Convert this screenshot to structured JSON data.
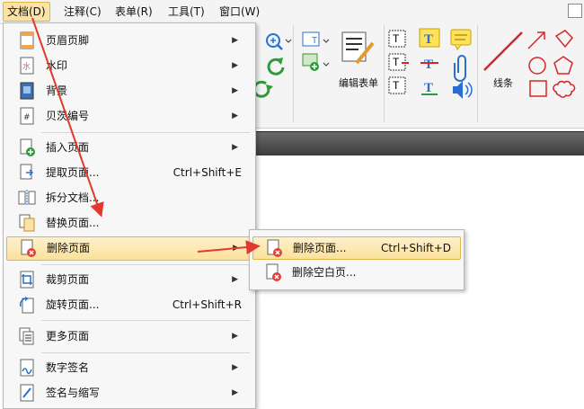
{
  "menubar": {
    "items": [
      {
        "label": "文档(D)",
        "active": true
      },
      {
        "label": "注释(C)"
      },
      {
        "label": "表单(R)"
      },
      {
        "label": "工具(T)"
      },
      {
        "label": "窗口(W)"
      }
    ]
  },
  "toolbar": {
    "edit_form_label": "编辑表单",
    "lines_label": "线条"
  },
  "doc_menu": {
    "items": [
      {
        "label": "页眉页脚",
        "submenu": true,
        "icon": "header-footer-icon"
      },
      {
        "label": "水印",
        "submenu": true,
        "icon": "watermark-icon"
      },
      {
        "label": "背景",
        "submenu": true,
        "icon": "background-icon"
      },
      {
        "label": "贝茨编号",
        "submenu": true,
        "icon": "bates-number-icon"
      },
      {
        "label": "插入页面",
        "submenu": true,
        "icon": "insert-page-icon"
      },
      {
        "label": "提取页面...",
        "shortcut": "Ctrl+Shift+E",
        "icon": "extract-page-icon"
      },
      {
        "label": "拆分文档...",
        "icon": "split-document-icon"
      },
      {
        "label": "替换页面...",
        "icon": "replace-page-icon"
      },
      {
        "label": "删除页面",
        "submenu": true,
        "highlighted": true,
        "icon": "delete-page-icon"
      },
      {
        "label": "裁剪页面",
        "submenu": true,
        "icon": "crop-page-icon"
      },
      {
        "label": "旋转页面...",
        "shortcut": "Ctrl+Shift+R",
        "icon": "rotate-page-icon"
      },
      {
        "label": "更多页面",
        "submenu": true,
        "icon": "more-pages-icon"
      },
      {
        "label": "数字签名",
        "submenu": true,
        "icon": "digital-signature-icon"
      },
      {
        "label": "签名与缩写",
        "submenu": true,
        "icon": "signature-initials-icon"
      }
    ]
  },
  "sub_menu": {
    "items": [
      {
        "label": "删除页面...",
        "shortcut": "Ctrl+Shift+D",
        "highlighted": true,
        "icon": "delete-page-icon"
      },
      {
        "label": "删除空白页...",
        "icon": "delete-blank-page-icon"
      }
    ]
  },
  "colors": {
    "highlight_bg": "#fbe19a",
    "highlight_border": "#e2b64d",
    "annotation_arrow": "#e03a2f",
    "shape_red": "#d9232a"
  }
}
